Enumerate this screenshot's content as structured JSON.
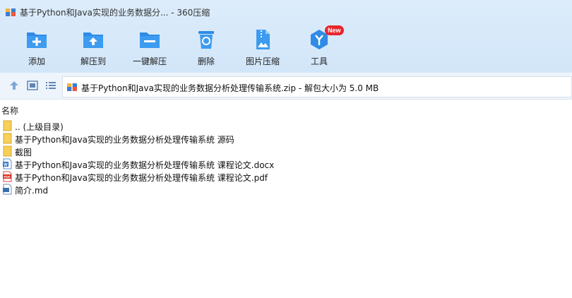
{
  "window": {
    "title": "基于Python和Java实现的业务数据分... - 360压缩"
  },
  "toolbar": {
    "items": [
      {
        "label": "添加",
        "icon": "add-icon"
      },
      {
        "label": "解压到",
        "icon": "extract-to-icon"
      },
      {
        "label": "一键解压",
        "icon": "one-click-extract-icon"
      },
      {
        "label": "删除",
        "icon": "delete-icon"
      },
      {
        "label": "图片压缩",
        "icon": "image-compress-icon"
      },
      {
        "label": "工具",
        "icon": "tools-icon",
        "badge": "New"
      }
    ]
  },
  "address": {
    "text": "基于Python和Java实现的业务数据分析处理传输系统.zip - 解包大小为 5.0 MB"
  },
  "list": {
    "column_name": "名称",
    "rows": [
      {
        "name": ".. (上级目录)",
        "icon": "parent-folder-icon"
      },
      {
        "name": "基于Python和Java实现的业务数据分析处理传输系统 源码",
        "icon": "folder-icon"
      },
      {
        "name": "截图",
        "icon": "folder-icon"
      },
      {
        "name": "基于Python和Java实现的业务数据分析处理传输系统 课程论文.docx",
        "icon": "word-document-icon"
      },
      {
        "name": "基于Python和Java实现的业务数据分析处理传输系统 课程论文.pdf",
        "icon": "pdf-icon"
      },
      {
        "name": "简介.md",
        "icon": "markdown-file-icon"
      }
    ]
  },
  "colors": {
    "accent": "#2b8ae0",
    "toolbar_bg": "#d6e8fa",
    "badge": "#e8262e"
  }
}
